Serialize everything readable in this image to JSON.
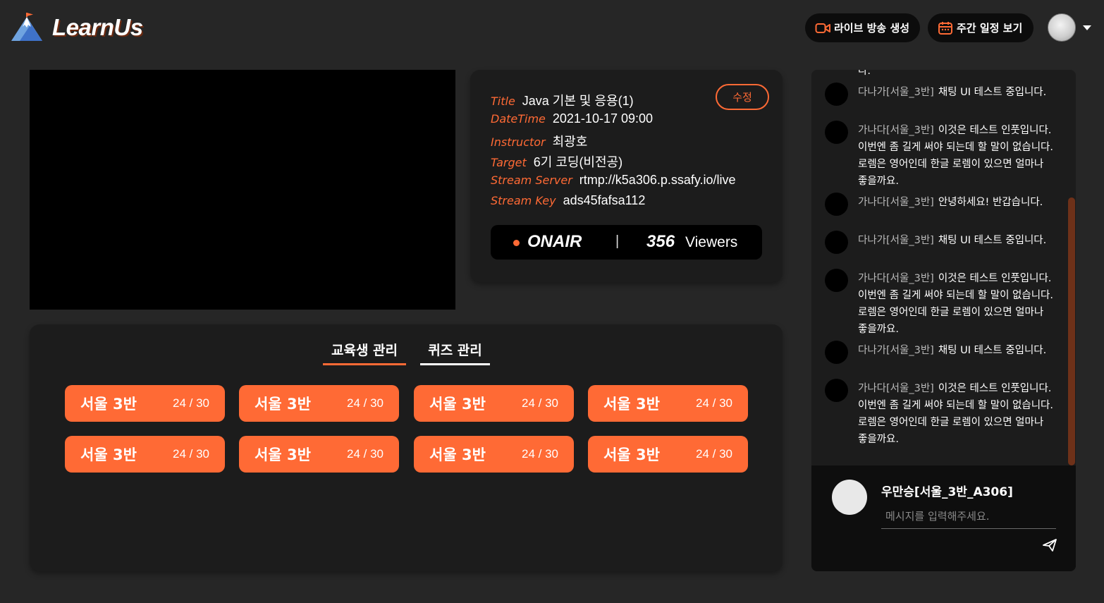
{
  "header": {
    "logo_text": "LearnUs",
    "create_live_label": "라이브 방송 생성",
    "weekly_schedule_label": "주간 일정 보기"
  },
  "lecture": {
    "edit_label": "수정",
    "fields": [
      {
        "key": "Title",
        "value": "Java 기본 및 응용(1)"
      },
      {
        "key": "DateTime",
        "value": "2021-10-17 09:00"
      },
      {
        "key": "Instructor",
        "value": "최광호"
      },
      {
        "key": "Target",
        "value": "6기 코딩(비전공)"
      },
      {
        "key": "Stream Server",
        "value": "rtmp://k5a306.p.ssafy.io/live"
      },
      {
        "key": "Stream Key",
        "value": "ads45fafsa112"
      }
    ],
    "status": {
      "onair_label": "ONAIR",
      "separator": "|",
      "viewer_count": "356",
      "viewer_label": "Viewers"
    }
  },
  "manage": {
    "tabs": [
      {
        "label": "교육생 관리",
        "active": true
      },
      {
        "label": "퀴즈 관리",
        "active": false
      }
    ],
    "classes": [
      {
        "name": "서울 3반",
        "count": "24 / 30"
      },
      {
        "name": "서울 3반",
        "count": "24 / 30"
      },
      {
        "name": "서울 3반",
        "count": "24 / 30"
      },
      {
        "name": "서울 3반",
        "count": "24 / 30"
      },
      {
        "name": "서울 3반",
        "count": "24 / 30"
      },
      {
        "name": "서울 3반",
        "count": "24 / 30"
      },
      {
        "name": "서울 3반",
        "count": "24 / 30"
      },
      {
        "name": "서울 3반",
        "count": "24 / 30"
      }
    ]
  },
  "chat": {
    "partial_top": "다.",
    "messages": [
      {
        "user": "다나가[서울_3반]",
        "text": "채팅 UI 테스트 중입니다."
      },
      {
        "user": "가나다[서울_3반]",
        "text": "이것은 테스트 인풋입니다. 이번엔 좀 길게 써야 되는데 할 말이 없습니다. 로렘은 영어인데 한글 로렘이 있으면 얼마나 좋을까요."
      },
      {
        "user": "가나다[서울_3반]",
        "text": "안녕하세요! 반갑습니다."
      },
      {
        "user": "다나가[서울_3반]",
        "text": "채팅 UI 테스트 중입니다."
      },
      {
        "user": "가나다[서울_3반]",
        "text": "이것은 테스트 인풋입니다. 이번엔 좀 길게 써야 되는데 할 말이 없습니다. 로렘은 영어인데 한글 로렘이 있으면 얼마나 좋을까요."
      },
      {
        "user": "다나가[서울_3반]",
        "text": "채팅 UI 테스트 중입니다."
      },
      {
        "user": "가나다[서울_3반]",
        "text": "이것은 테스트 인풋입니다. 이번엔 좀 길게 써야 되는데 할 말이 없습니다. 로렘은 영어인데 한글 로렘이 있으면 얼마나 좋을까요."
      }
    ],
    "current_user": "우만승[서울_3반_A306]",
    "input_placeholder": "메시지를 입력해주세요."
  },
  "icons": {
    "create_live": "video-camera-icon",
    "weekly_schedule": "calendar-icon",
    "send": "send-icon",
    "dropdown": "chevron-down-icon"
  },
  "colors": {
    "accent": "#ff6a35",
    "background": "#262626",
    "panel": "#1c1c1c"
  }
}
